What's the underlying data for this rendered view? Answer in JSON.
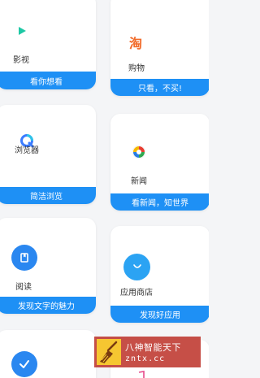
{
  "cards": [
    {
      "name": "影视",
      "banner": "看你想看",
      "icon": "play-icon"
    },
    {
      "name": "购物",
      "banner": "只看，不买!",
      "icon": "taobao-icon"
    },
    {
      "name": "浏览器",
      "banner": "简洁浏览",
      "icon": "browser-icon"
    },
    {
      "name": "新闻",
      "banner": "看新闻，知世界",
      "icon": "news-icon"
    },
    {
      "name": "阅读",
      "banner": "发现文字的魅力",
      "icon": "book-icon"
    },
    {
      "name": "应用商店",
      "banner": "发现好应用",
      "icon": "store-icon"
    }
  ],
  "watermark": {
    "line1": "八神智能天下",
    "line2": "zntx.cc"
  },
  "colors": {
    "banner": "#1e90f5",
    "accent": "#1e90f5",
    "shop_orange": "#f26b2a"
  }
}
